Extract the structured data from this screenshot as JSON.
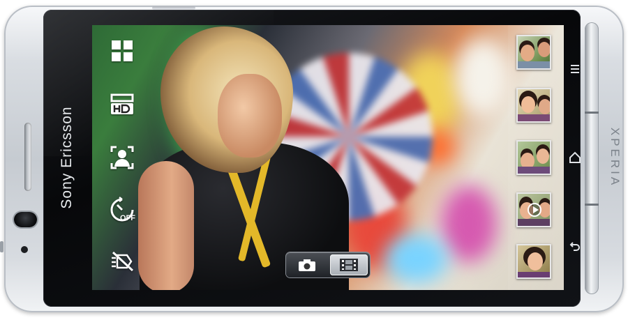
{
  "device": {
    "brand": "Sony Ericsson",
    "model": "XPERIA"
  },
  "camera_controls": {
    "items": [
      {
        "id": "scenes",
        "icon": "grid-icon"
      },
      {
        "id": "resolution",
        "icon": "hd-icon"
      },
      {
        "id": "focus-mode",
        "icon": "face-detection-icon"
      },
      {
        "id": "self-timer",
        "icon": "self-timer-off-icon"
      },
      {
        "id": "flash",
        "icon": "flash-off-icon"
      }
    ]
  },
  "mode_switch": {
    "options": [
      {
        "id": "photo",
        "icon": "camera-icon",
        "active": false
      },
      {
        "id": "video",
        "icon": "film-icon",
        "active": true
      }
    ]
  },
  "thumbnails": {
    "items": [
      {
        "id": 1,
        "type": "photo"
      },
      {
        "id": 2,
        "type": "photo"
      },
      {
        "id": 3,
        "type": "photo"
      },
      {
        "id": 4,
        "type": "video"
      },
      {
        "id": 5,
        "type": "photo"
      }
    ]
  },
  "nav_keys": [
    {
      "id": "menu",
      "icon": "menu-icon"
    },
    {
      "id": "home",
      "icon": "home-icon"
    },
    {
      "id": "back",
      "icon": "back-icon"
    }
  ],
  "colors": {
    "accent_yellow": "#e3b829",
    "bezel": "#0b0c0e",
    "chrome": "#c6cbd1",
    "icon_white": "#ffffff"
  }
}
